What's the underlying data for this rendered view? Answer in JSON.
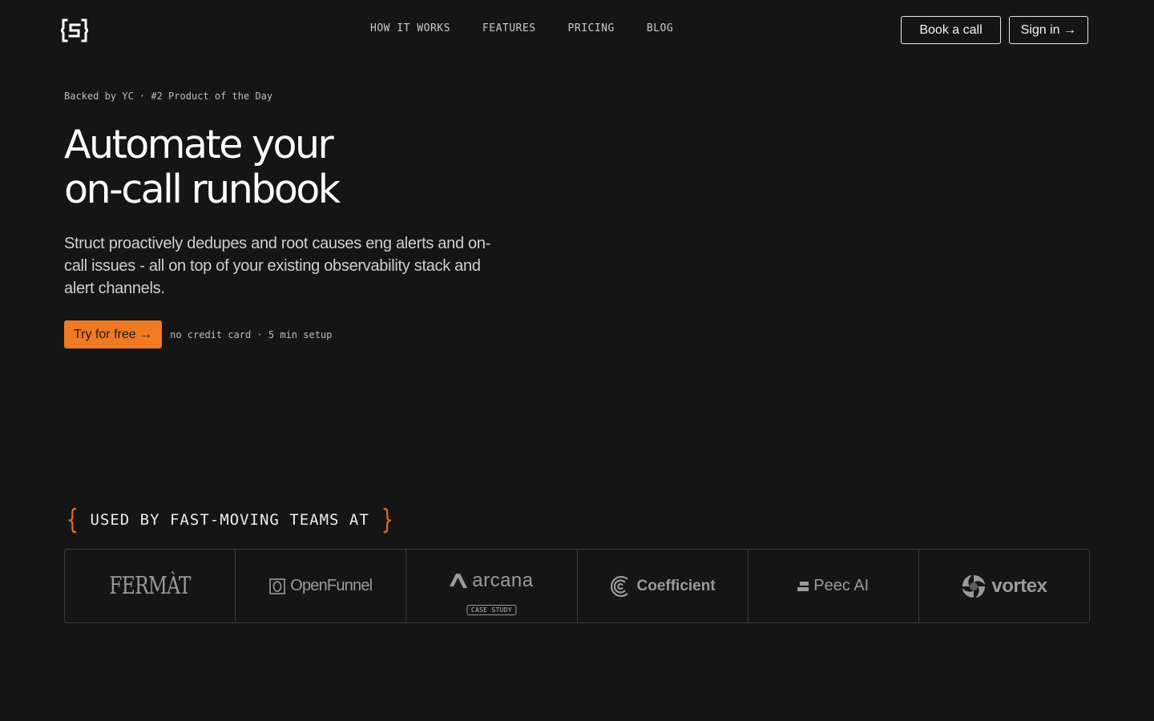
{
  "header": {
    "nav": [
      {
        "label": "HOW IT WORKS"
      },
      {
        "label": "FEATURES"
      },
      {
        "label": "PRICING"
      },
      {
        "label": "BLOG"
      }
    ],
    "book_call_label": "Book a call",
    "sign_in_label": "Sign in →"
  },
  "hero": {
    "eyebrow": "Backed by YC · #2 Product of the Day",
    "title_line1": "Automate your",
    "title_line2": "on-call runbook",
    "subtitle": "Struct proactively dedupes and root causes eng alerts and on-call issues - all on top of your existing observability stack and alert channels.",
    "cta_label": "Try for free →",
    "cta_note": "no credit card · 5 min setup"
  },
  "customers": {
    "heading": "USED BY FAST-MOVING TEAMS AT",
    "logos": [
      {
        "name": "FERMÀT"
      },
      {
        "name": "OpenFunnel"
      },
      {
        "name": "arcana",
        "badge": "CASE STUDY"
      },
      {
        "name": "Coefficient"
      },
      {
        "name": "Peec AI"
      },
      {
        "name": "vortex"
      }
    ]
  },
  "colors": {
    "background": "#151515",
    "accent": "#f07a24",
    "text": "#f2f2f2",
    "muted": "#9a9a9a"
  },
  "icons": {
    "logo": "struct-s-bracket-icon"
  }
}
